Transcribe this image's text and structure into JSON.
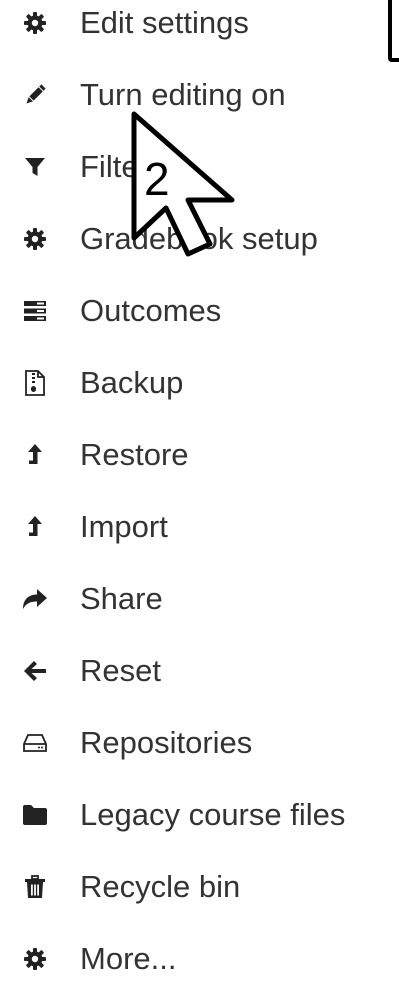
{
  "menu": {
    "items": [
      {
        "label": "Edit settings",
        "icon": "gear-icon"
      },
      {
        "label": "Turn editing on",
        "icon": "pencil-icon"
      },
      {
        "label": "Filters",
        "icon": "filter-icon"
      },
      {
        "label": "Gradebook setup",
        "icon": "gear-icon"
      },
      {
        "label": "Outcomes",
        "icon": "outcomes-icon"
      },
      {
        "label": "Backup",
        "icon": "file-archive-icon"
      },
      {
        "label": "Restore",
        "icon": "upload-arrow-icon"
      },
      {
        "label": "Import",
        "icon": "upload-arrow-icon"
      },
      {
        "label": "Share",
        "icon": "share-icon"
      },
      {
        "label": "Reset",
        "icon": "arrow-left-icon"
      },
      {
        "label": "Repositories",
        "icon": "hdd-icon"
      },
      {
        "label": "Legacy course files",
        "icon": "folder-icon"
      },
      {
        "label": "Recycle bin",
        "icon": "trash-icon"
      },
      {
        "label": "More...",
        "icon": "gear-icon"
      }
    ]
  },
  "annotation": {
    "step_number": "2"
  },
  "colors": {
    "text": "#333333",
    "icon": "#222222",
    "background": "#ffffff"
  }
}
